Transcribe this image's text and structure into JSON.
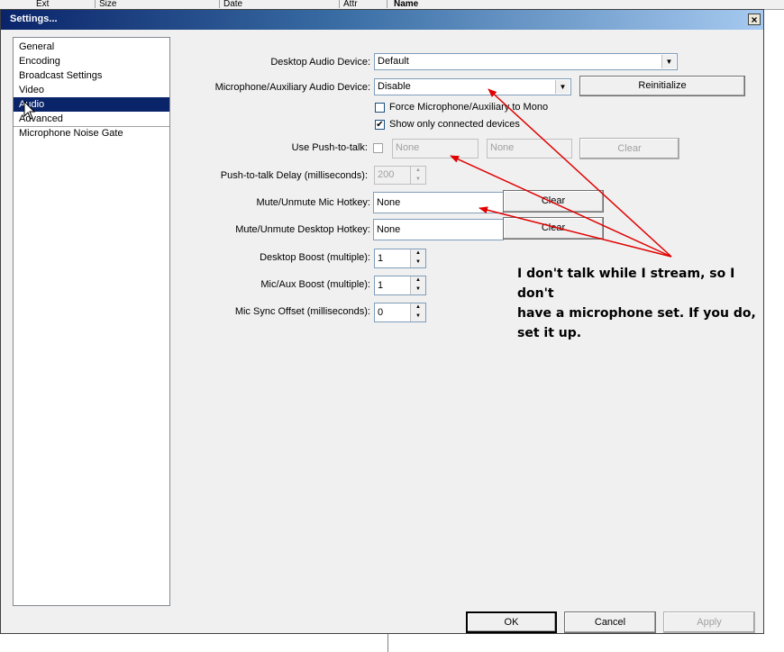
{
  "background": {
    "columns": [
      "Ext",
      "Size",
      "Date",
      "Attr",
      "Name"
    ]
  },
  "window": {
    "title": "Settings...",
    "close_glyph": "×"
  },
  "nav": {
    "items": [
      {
        "label": "General",
        "selected": false
      },
      {
        "label": "Encoding",
        "selected": false
      },
      {
        "label": "Broadcast Settings",
        "selected": false
      },
      {
        "label": "Video",
        "selected": false
      },
      {
        "label": "Audio",
        "selected": true
      },
      {
        "label": "Advanced",
        "selected": false
      },
      {
        "label": "Microphone Noise Gate",
        "selected": false
      }
    ]
  },
  "audio": {
    "desktop_device_label": "Desktop Audio Device:",
    "desktop_device_value": "Default",
    "mic_device_label": "Microphone/Auxiliary Audio Device:",
    "mic_device_value": "Disable",
    "reinitialize_label": "Reinitialize",
    "force_mono_label": "Force Microphone/Auxiliary to Mono",
    "force_mono_checked": false,
    "show_connected_label": "Show only connected devices",
    "show_connected_checked": true,
    "ptt_label": "Use Push-to-talk:",
    "ptt_checked": false,
    "ptt_hotkey1": "None",
    "ptt_hotkey2": "None",
    "ptt_clear_label": "Clear",
    "ptt_delay_label": "Push-to-talk Delay (milliseconds):",
    "ptt_delay_value": "200",
    "mute_mic_label": "Mute/Unmute Mic Hotkey:",
    "mute_mic_value": "None",
    "mute_mic_clear_label": "Clear",
    "mute_desktop_label": "Mute/Unmute Desktop Hotkey:",
    "mute_desktop_value": "None",
    "mute_desktop_clear_label": "Clear",
    "desktop_boost_label": "Desktop Boost (multiple):",
    "desktop_boost_value": "1",
    "mic_boost_label": "Mic/Aux Boost (multiple):",
    "mic_boost_value": "1",
    "mic_sync_label": "Mic Sync Offset (milliseconds):",
    "mic_sync_value": "0"
  },
  "annotation": {
    "line1": "I don't talk while I stream, so I don't",
    "line2": "have a microphone set. If you do,",
    "line3": "set it up.",
    "arrow_color": "#e00000"
  },
  "footer": {
    "ok_label": "OK",
    "cancel_label": "Cancel",
    "apply_label": "Apply"
  }
}
